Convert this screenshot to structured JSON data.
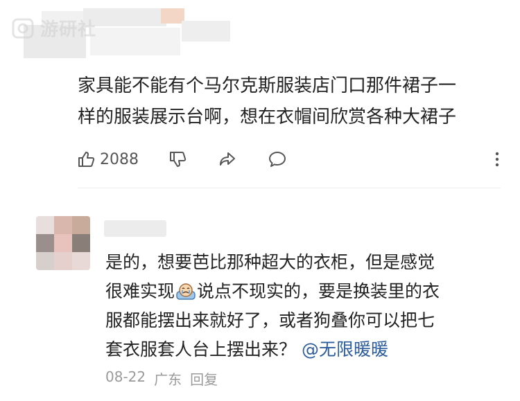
{
  "watermark": {
    "text": "游研社"
  },
  "comment": {
    "text_line1": "家具能不能有个马尔克斯服装店门口那件裙子一",
    "text_line2": "样的服装展示台啊，想在衣帽间欣赏各种大裙子",
    "likes": "2088"
  },
  "reply": {
    "line1": "是的，想要芭比那种超大的衣柜，但是感觉",
    "line2_a": "很难实现",
    "line2_b": "说点不现实的，要是换装里的衣",
    "line3": "服都能摆出来就好了，或者狗叠你可以把七",
    "line4_a": "套衣服套人台上摆出来？",
    "mention": "@无限暖暖",
    "date": "08-22",
    "location": "广东",
    "reply_label": "回复"
  },
  "icons": {
    "like": "thumbs-up-icon",
    "dislike": "thumbs-down-icon",
    "share": "share-icon",
    "comment": "comment-icon",
    "more": "more-vertical-icon",
    "emoji": "crying-emoji-icon"
  },
  "colors": {
    "mention": "#2c5c9c",
    "meta": "#9a9a9a",
    "text": "#222222"
  }
}
